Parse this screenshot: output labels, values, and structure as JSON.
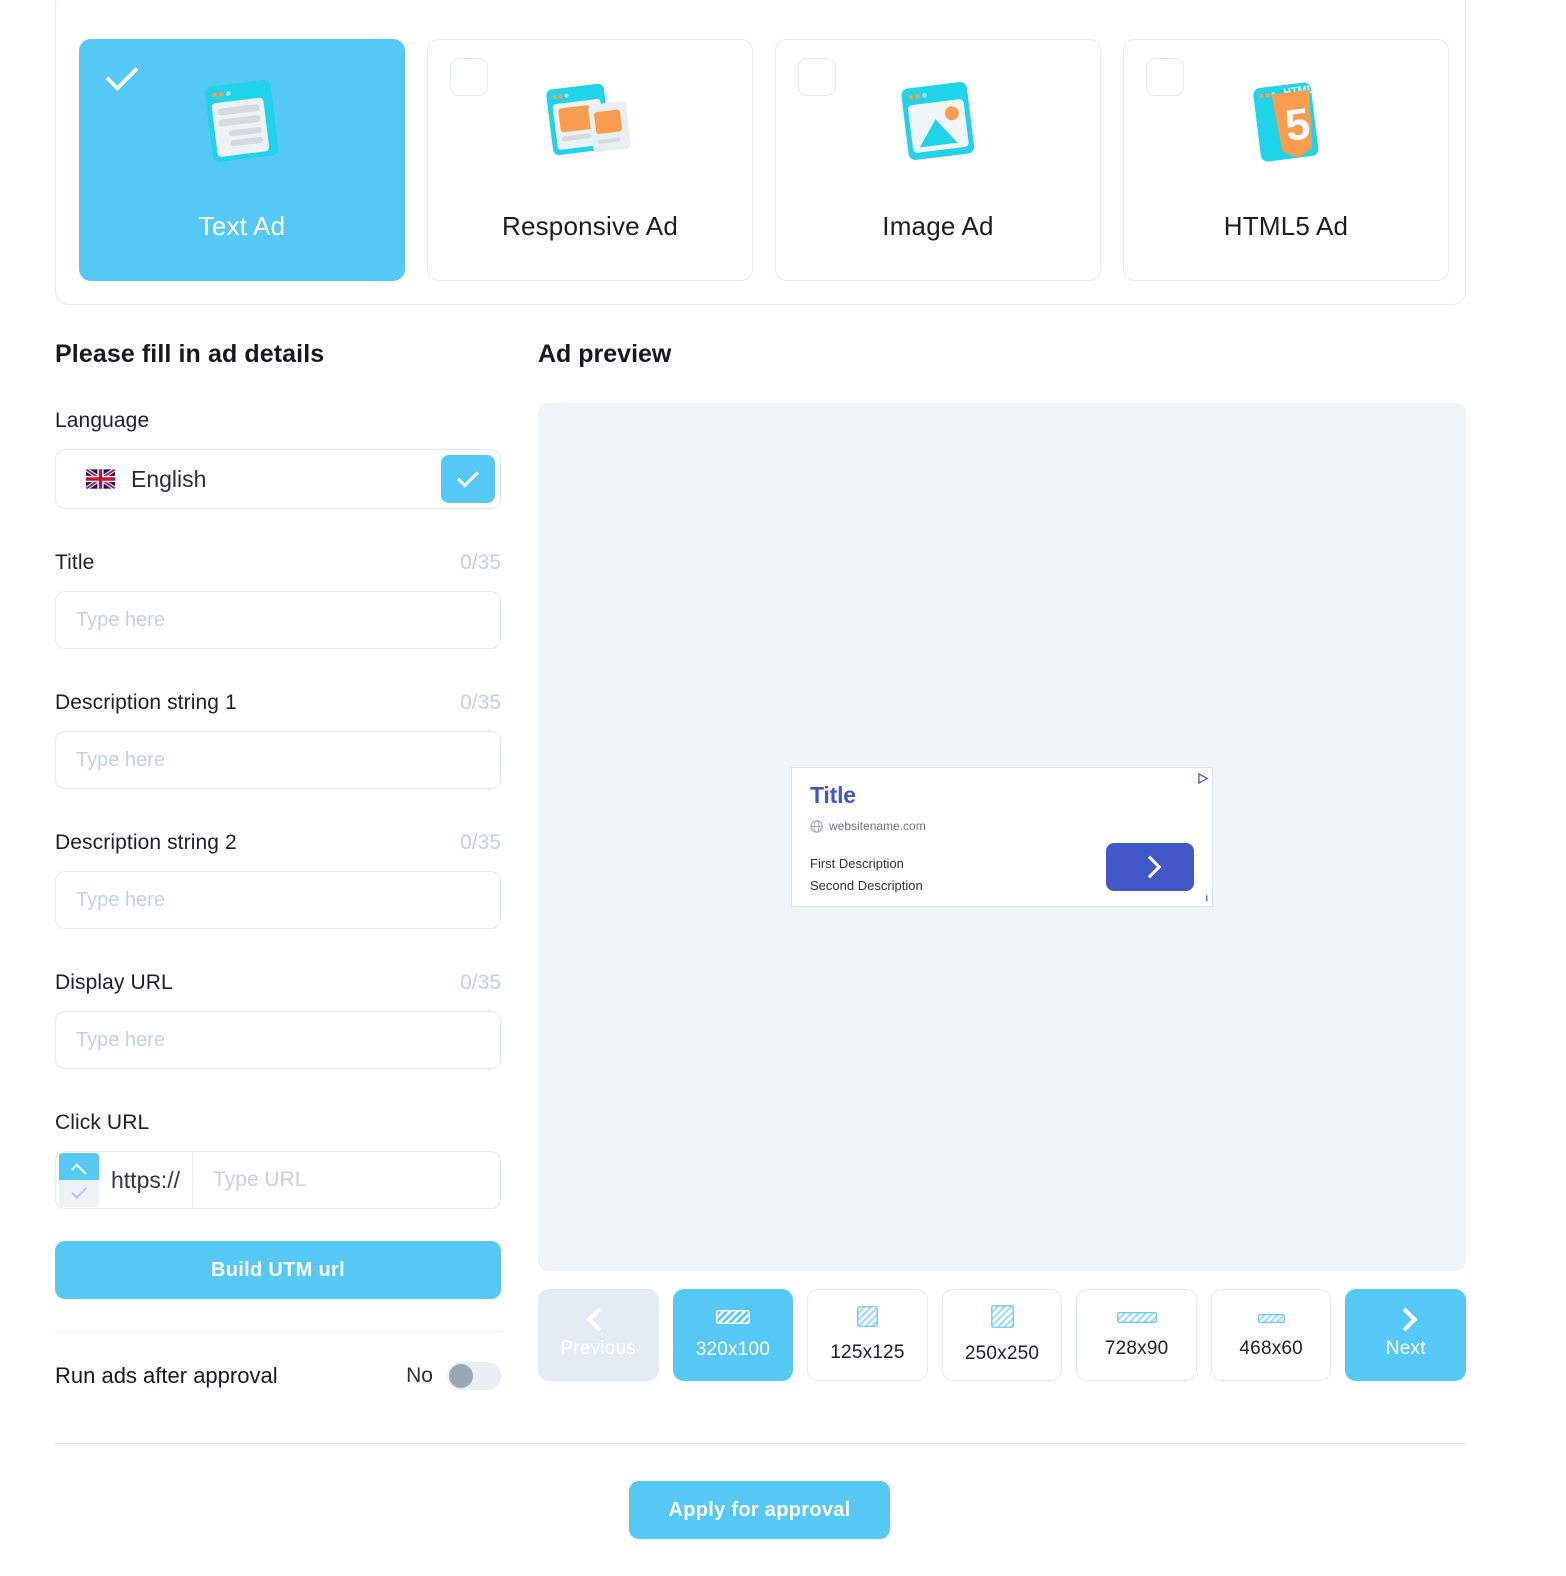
{
  "theme": {
    "accent": "#55c8f5",
    "panel_border": "#e3e9f2",
    "preview_bg": "#eef4f8",
    "counter_color": "#c2d2e3",
    "placeholder_color": "#c3d1e0",
    "banner_blue": "#4258c9",
    "nav_disabled_bg": "#e4ebf5",
    "toggle_track": "#e8eef6",
    "toggle_knob": "#9aa6b2"
  },
  "ad_types": [
    {
      "label": "Text Ad",
      "icon": "text-ad-icon",
      "selected": true
    },
    {
      "label": "Responsive Ad",
      "icon": "responsive-ad-icon",
      "selected": false
    },
    {
      "label": "Image Ad",
      "icon": "image-ad-icon",
      "selected": false
    },
    {
      "label": "HTML5 Ad",
      "icon": "html5-ad-icon",
      "selected": false
    }
  ],
  "form": {
    "section_title": "Please fill in ad details",
    "language": {
      "label": "Language",
      "value": "English",
      "flag": "uk-flag-icon",
      "caret": "chevron-down-icon"
    },
    "fields": [
      {
        "label": "Title",
        "counter": "0/35",
        "value": "",
        "placeholder": "Type here"
      },
      {
        "label": "Description string 1",
        "counter": "0/35",
        "value": "",
        "placeholder": "Type here"
      },
      {
        "label": "Description string 2",
        "counter": "0/35",
        "value": "",
        "placeholder": "Type here"
      },
      {
        "label": "Display URL",
        "counter": "0/35",
        "value": "",
        "placeholder": "Type here"
      }
    ],
    "click_url": {
      "label": "Click URL",
      "scheme": "https://",
      "value": "",
      "placeholder": "Type URL",
      "spinner_up": "chevron-up-icon",
      "spinner_down": "chevron-down-icon"
    },
    "build_utm_label": "Build UTM url",
    "approval": {
      "label": "Run ads after approval",
      "state_text": "No",
      "enabled": false
    }
  },
  "preview": {
    "title": "Ad preview",
    "banner": {
      "title": "Title",
      "website": "websitename.com",
      "globe": "globe-icon",
      "description_1": "First Description",
      "description_2": "Second Description",
      "cta": "chevron-right-icon",
      "adchoices": "adchoices-triangle-icon",
      "info_badge": "i"
    },
    "nav": {
      "previous_label": "Previous",
      "next_label": "Next",
      "previous_icon": "chevron-left-icon",
      "next_icon": "chevron-right-icon",
      "previous_disabled": true
    },
    "sizes": [
      {
        "label": "320x100",
        "thumb": "banner-320x100-icon",
        "active": true
      },
      {
        "label": "125x125",
        "thumb": "banner-125x125-icon",
        "active": false
      },
      {
        "label": "250x250",
        "thumb": "banner-250x250-icon",
        "active": false
      },
      {
        "label": "728x90",
        "thumb": "banner-728x90-icon",
        "active": false
      },
      {
        "label": "468x60",
        "thumb": "banner-468x60-icon",
        "active": false
      }
    ]
  },
  "footer": {
    "apply_label": "Apply for approval"
  }
}
